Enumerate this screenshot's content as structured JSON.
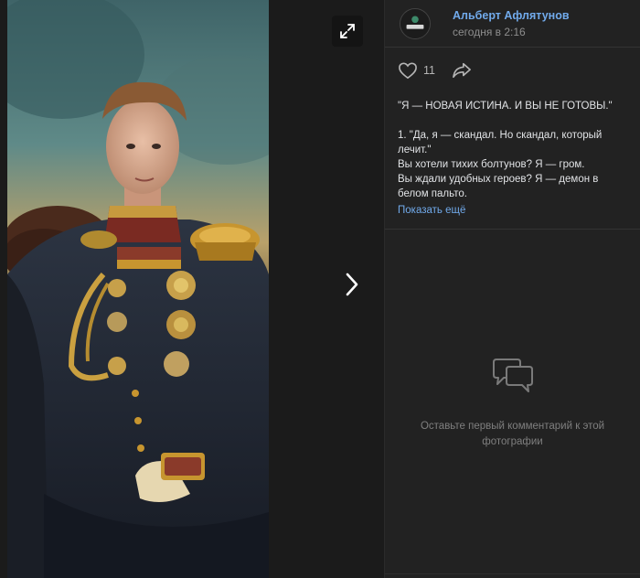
{
  "viewer": {
    "expand_icon": "expand-icon",
    "next_icon": "chevron-right-icon"
  },
  "author": {
    "name": "Альберт Афлятунов",
    "time": "сегодня в 2:16",
    "avatar_icon": "avatar-logo"
  },
  "actions": {
    "like_icon": "heart-icon",
    "like_count": "11",
    "share_icon": "share-icon"
  },
  "post": {
    "headline": "\"Я — НОВАЯ ИСТИНА. И ВЫ НЕ ГОТОВЫ.\"",
    "lines": [
      "1. \"Да, я — скандал. Но скандал, который лечит.\"",
      "Вы хотели тихих болтунов? Я — гром.",
      "Вы ждали удобных героев? Я — демон в белом пальто."
    ],
    "show_more": "Показать ещё"
  },
  "comments": {
    "empty_icon": "comments-icon",
    "empty_text": "Оставьте первый комментарий к этой фотографии"
  },
  "colors": {
    "link": "#71aaeb",
    "background": "#222222",
    "text": "#e1e3e6"
  }
}
